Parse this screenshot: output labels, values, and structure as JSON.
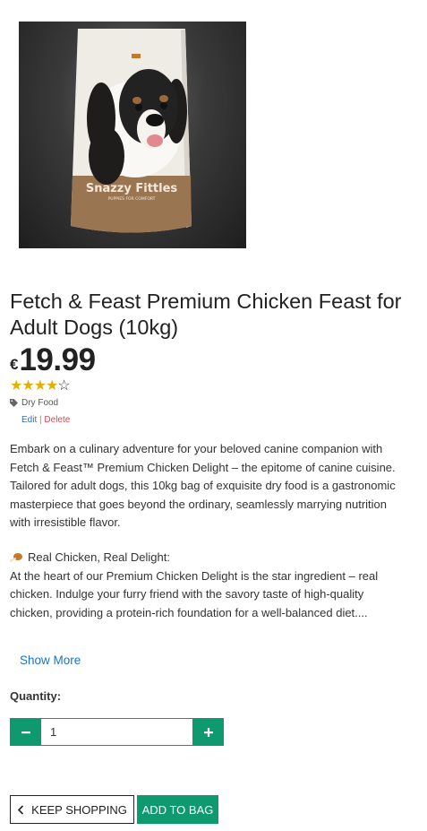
{
  "product": {
    "image_alt": "dog-food-bag",
    "bag_brand": "Snazzy Fittles",
    "bag_sub": "PUPPIES FOR COMFORT",
    "title": "Fetch & Feast Premium Chicken Feast for Adult Dogs (10kg)",
    "currency": "€",
    "price": "19.99",
    "rating": 4,
    "rating_max": 5,
    "stars_filled": "★★★★",
    "stars_empty": "☆",
    "category": "Dry Food",
    "category_icon": "tag-icon"
  },
  "admin": {
    "edit_label": "Edit",
    "separator": "|",
    "delete_label": "Delete"
  },
  "description": {
    "intro": "Embark on a culinary adventure for your beloved canine companion with Fetch & Feast™ Premium Chicken Delight – the epitome of canine cuisine. Tailored for adult dogs, this 10kg bag of exquisite dry food is a gastronomic masterpiece that goes beyond the ordinary, seamlessly marrying nutrition with irresistible flavor.",
    "feature_icon": "chicken-leg-icon",
    "feature_title": "Real Chicken, Real Delight:",
    "feature_text": "At the heart of our Premium Chicken Delight is the star ingredient – real chicken. Indulge your furry friend with the savory taste of high-quality chicken, providing a protein-rich foundation for a well-balanced diet....",
    "show_more_label": "Show More"
  },
  "quantity": {
    "label": "Quantity:",
    "value": "1",
    "minus_icon": "minus-icon",
    "plus_icon": "plus-icon"
  },
  "actions": {
    "keep_shopping_label": "KEEP SHOPPING",
    "keep_shopping_icon": "chevron-left-icon",
    "add_to_bag_label": "ADD TO BAG"
  },
  "colors": {
    "accent": "#0e9a6e",
    "link": "#1a73c9",
    "danger": "#e0454d",
    "star": "#e0b100"
  }
}
